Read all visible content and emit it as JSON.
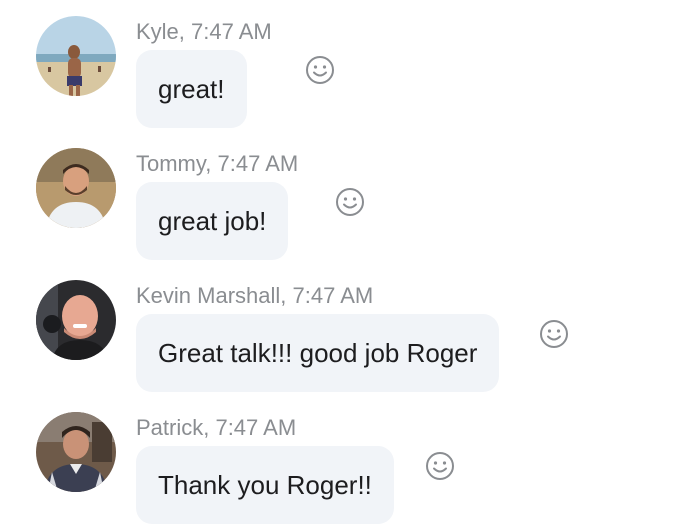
{
  "messages": [
    {
      "author": "Kyle",
      "time": "7:47 AM",
      "meta": "Kyle, 7:47 AM",
      "text": "great!",
      "avatar": "beach-photo",
      "reaction_icon": "smiley-icon"
    },
    {
      "author": "Tommy",
      "time": "7:47 AM",
      "meta": "Tommy, 7:47 AM",
      "text": "great job!",
      "avatar": "field-photo",
      "reaction_icon": "smiley-icon"
    },
    {
      "author": "Kevin Marshall",
      "time": "7:47 AM",
      "meta": "Kevin Marshall, 7:47 AM",
      "text": "Great talk!!! good job Roger",
      "avatar": "studio-photo",
      "reaction_icon": "smiley-icon"
    },
    {
      "author": "Patrick",
      "time": "7:47 AM",
      "meta": "Patrick, 7:47 AM",
      "text": "Thank you Roger!!",
      "avatar": "office-photo",
      "reaction_icon": "smiley-icon"
    }
  ],
  "colors": {
    "meta_text": "#8a8d91",
    "bubble_bg": "#f1f4f8",
    "message_text": "#1d1d1f",
    "icon_stroke": "#8a8d91"
  }
}
